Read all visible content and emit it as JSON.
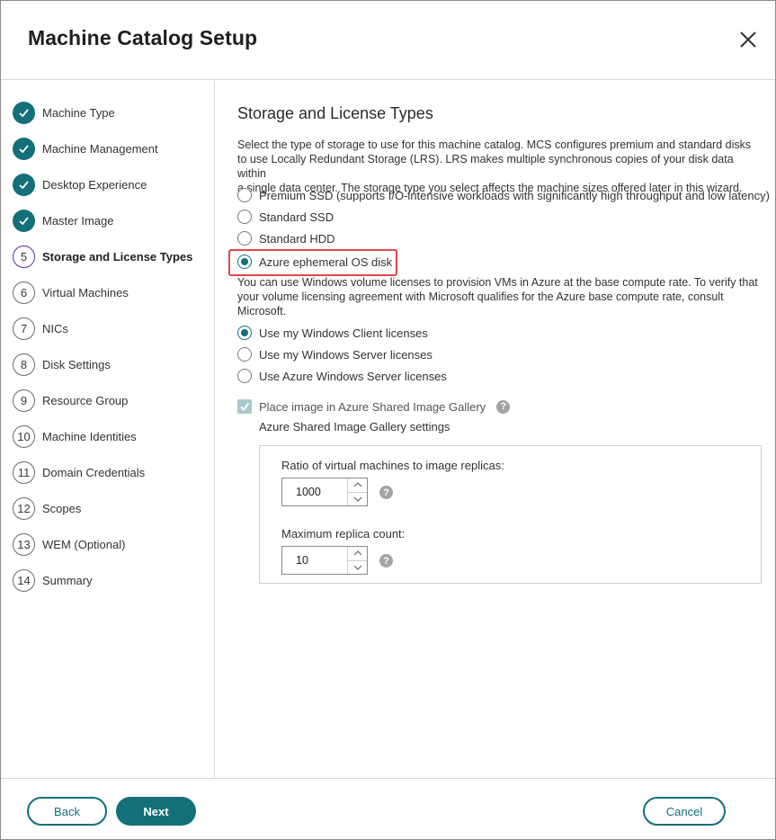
{
  "dialog": {
    "title": "Machine Catalog Setup"
  },
  "steps": [
    {
      "num": "1",
      "label": "Machine Type",
      "state": "done"
    },
    {
      "num": "2",
      "label": "Machine Management",
      "state": "done"
    },
    {
      "num": "3",
      "label": "Desktop Experience",
      "state": "done"
    },
    {
      "num": "4",
      "label": "Master Image",
      "state": "done"
    },
    {
      "num": "5",
      "label": "Storage and License Types",
      "state": "current"
    },
    {
      "num": "6",
      "label": "Virtual Machines",
      "state": "todo"
    },
    {
      "num": "7",
      "label": "NICs",
      "state": "todo"
    },
    {
      "num": "8",
      "label": "Disk Settings",
      "state": "todo"
    },
    {
      "num": "9",
      "label": "Resource Group",
      "state": "todo"
    },
    {
      "num": "10",
      "label": "Machine Identities",
      "state": "todo"
    },
    {
      "num": "11",
      "label": "Domain Credentials",
      "state": "todo"
    },
    {
      "num": "12",
      "label": "Scopes",
      "state": "todo"
    },
    {
      "num": "13",
      "label": "WEM (Optional)",
      "state": "todo"
    },
    {
      "num": "14",
      "label": "Summary",
      "state": "todo"
    }
  ],
  "main": {
    "heading": "Storage and License Types",
    "storage_desc_lines": [
      "Select the type of storage to use for this machine catalog. MCS configures premium and standard disks",
      "to use Locally Redundant Storage (LRS). LRS makes multiple synchronous copies of your disk data within",
      "a single data center. The storage type you select affects the machine sizes offered later in this wizard."
    ],
    "storage_options": [
      {
        "label": "Premium SSD (supports I/O-intensive workloads with significantly high throughput and low latency)",
        "selected": false
      },
      {
        "label": "Standard SSD",
        "selected": false
      },
      {
        "label": "Standard HDD",
        "selected": false
      },
      {
        "label": "Azure ephemeral OS disk",
        "selected": true
      }
    ],
    "license_desc_lines": [
      "You can use Windows volume licenses to provision VMs in Azure at the base compute rate. To verify that",
      "your volume licensing agreement with Microsoft qualifies for the Azure base compute rate, consult",
      "Microsoft."
    ],
    "license_options": [
      {
        "label": "Use my Windows Client licenses",
        "selected": true
      },
      {
        "label": "Use my Windows Server licenses",
        "selected": false
      },
      {
        "label": "Use Azure Windows Server licenses",
        "selected": false
      }
    ],
    "gallery_checkbox": {
      "label": "Place image in Azure Shared Image Gallery",
      "checked": true,
      "disabled": true
    },
    "gallery_settings_label": "Azure Shared Image Gallery settings",
    "ratio": {
      "label": "Ratio of virtual machines to image replicas:",
      "value": "1000"
    },
    "max_replica": {
      "label": "Maximum replica count:",
      "value": "10"
    },
    "help_glyph": "?"
  },
  "footer": {
    "back": "Back",
    "next": "Next",
    "cancel": "Cancel"
  },
  "colors": {
    "accent": "#136f7a",
    "current_step": "#5a2ea6",
    "highlight": "#e2474b"
  }
}
